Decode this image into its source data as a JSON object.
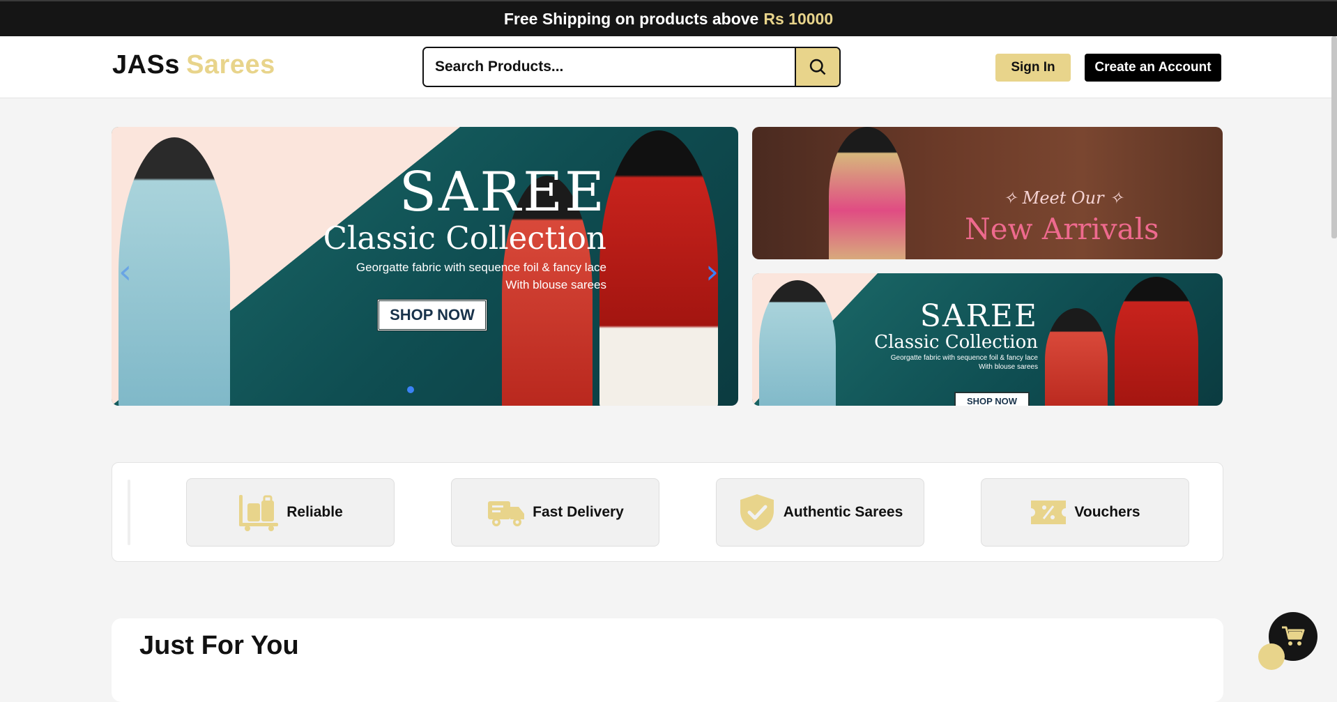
{
  "announcement": {
    "text": "Free Shipping on products above",
    "amount": "Rs 10000"
  },
  "header": {
    "logo_part1": "JASs",
    "logo_part2": "Sarees",
    "search_placeholder": "Search Products...",
    "signin_label": "Sign In",
    "create_account_label": "Create an Account"
  },
  "hero": {
    "main": {
      "title": "SAREE",
      "subtitle": "Classic Collection",
      "desc_line1": "Georgatte fabric with sequence foil & fancy lace",
      "desc_line2": "With blouse sarees",
      "cta": "SHOP NOW",
      "prev_arrow": "‹",
      "next_arrow": "›"
    },
    "side_top": {
      "eyebrow": "Meet Our",
      "title": "New Arrivals"
    },
    "side_bottom": {
      "title": "SAREE",
      "subtitle": "Classic Collection",
      "desc_line1": "Georgatte fabric with sequence foil & fancy lace",
      "desc_line2": "With blouse sarees",
      "cta": "SHOP NOW"
    }
  },
  "features": [
    {
      "label": "Reliable",
      "icon": "luggage-trolley-icon"
    },
    {
      "label": "Fast Delivery",
      "icon": "delivery-truck-icon"
    },
    {
      "label": "Authentic Sarees",
      "icon": "shield-check-icon"
    },
    {
      "label": "Vouchers",
      "icon": "voucher-ticket-icon"
    }
  ],
  "sections": {
    "just_for_you": "Just For You"
  },
  "colors": {
    "accent": "#e8d48b",
    "dark": "#151515",
    "background": "#f4f4f4",
    "slider_accent": "#3b82f6"
  }
}
